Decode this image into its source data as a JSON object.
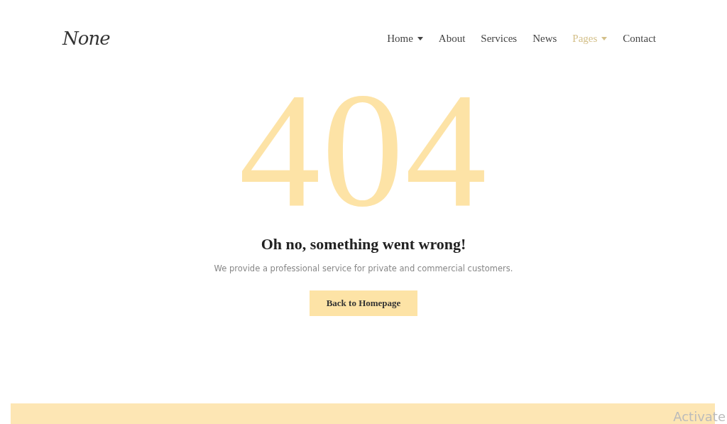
{
  "header": {
    "logo": "None",
    "nav": [
      {
        "label": "Home",
        "has_dropdown": true,
        "selected": false
      },
      {
        "label": "About",
        "has_dropdown": false,
        "selected": false
      },
      {
        "label": "Services",
        "has_dropdown": false,
        "selected": false
      },
      {
        "label": "News",
        "has_dropdown": false,
        "selected": false
      },
      {
        "label": "Pages",
        "has_dropdown": true,
        "selected": true
      },
      {
        "label": "Contact",
        "has_dropdown": false,
        "selected": false
      }
    ]
  },
  "error": {
    "code": "404",
    "heading": "Oh no, something went wrong!",
    "message": "We provide a professional service for private and commercial customers.",
    "button": "Back to Homepage"
  },
  "overlay": {
    "text": "Activate"
  }
}
